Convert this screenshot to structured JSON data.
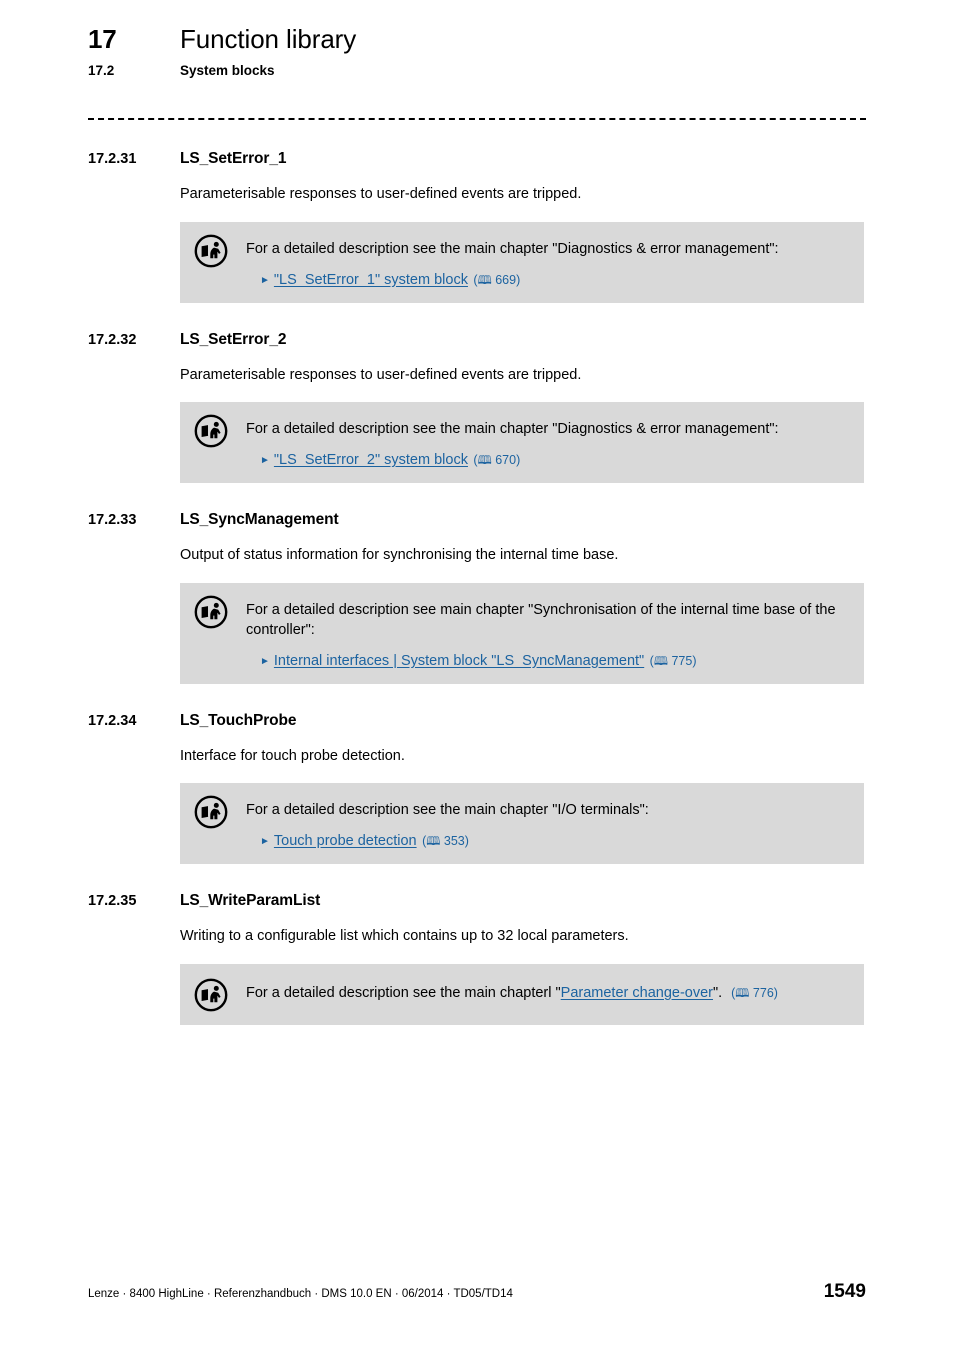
{
  "header": {
    "chapter_number": "17",
    "chapter_title": "Function library",
    "subchapter_number": "17.2",
    "subchapter_title": "System blocks"
  },
  "icons": {
    "info_icon": "read-manual-icon",
    "bullet_icon": "triangle-right-icon",
    "page_ref_icon": "book-icon",
    "book_glyph": "🕮"
  },
  "colors": {
    "link": "#1c63a0",
    "infobox_background": "#d9d9d9",
    "page_background": "#ffffff",
    "text": "#000000"
  },
  "sections": [
    {
      "number": "17.2.31",
      "title": "LS_SetError_1",
      "description": "Parameterisable responses to user-defined events are tripped.",
      "infobox": {
        "intro": "For a detailed description see the main chapter \"Diagnostics & error management\":",
        "link_text": "\"LS_SetError_1\" system block",
        "page_ref": "669"
      }
    },
    {
      "number": "17.2.32",
      "title": "LS_SetError_2",
      "description": "Parameterisable responses to user-defined events are tripped.",
      "infobox": {
        "intro": "For a detailed description see the main chapter \"Diagnostics & error management\":",
        "link_text": "\"LS_SetError_2\" system block",
        "page_ref": "670"
      }
    },
    {
      "number": "17.2.33",
      "title": "LS_SyncManagement",
      "description": "Output of status information for synchronising the internal time base.",
      "infobox": {
        "intro": "For a detailed description see main chapter \"Synchronisation of the internal time base of the controller\":",
        "link_text": "Internal interfaces | System block \"LS_SyncManagement\"",
        "page_ref": "775"
      }
    },
    {
      "number": "17.2.34",
      "title": "LS_TouchProbe",
      "description": "Interface for touch probe detection.",
      "infobox": {
        "intro": "For a detailed description see the main chapter \"I/O terminals\":",
        "link_text": "Touch probe detection",
        "page_ref": "353"
      }
    },
    {
      "number": "17.2.35",
      "title": "LS_WriteParamList",
      "description": "Writing to a configurable list which contains up to 32 local parameters.",
      "infobox": {
        "inline": true,
        "intro_before": "For a detailed description see the main chapterl \"",
        "link_text": "Parameter change-over",
        "intro_after": "\".",
        "page_ref": "776"
      }
    }
  ],
  "footer": {
    "text": "Lenze · 8400 HighLine · Referenzhandbuch · DMS 10.0 EN · 06/2014 · TD05/TD14",
    "page_number": "1549"
  }
}
